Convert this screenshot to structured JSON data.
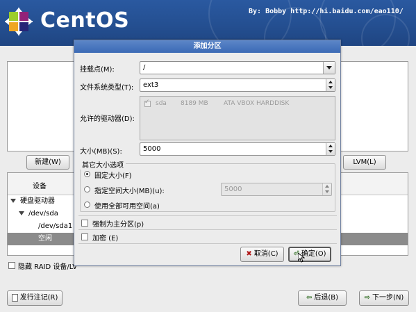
{
  "banner": {
    "logo_text": "CentOS",
    "byline": "By: Bobby http://hi.baidu.com/eao110/"
  },
  "main": {
    "new_button": "新建(W)",
    "lvm_button": "LVM(L)",
    "table": {
      "column_device": "设备",
      "rows": [
        {
          "label": "硬盘驱动器"
        },
        {
          "label": "/dev/sda"
        },
        {
          "label": "/dev/sda1"
        },
        {
          "label": "空闲"
        }
      ]
    },
    "hide_raid_label": "隐藏 RAID 设备/LV"
  },
  "dialog": {
    "title": "添加分区",
    "mount_point": {
      "label": "挂载点(M):",
      "value": "/"
    },
    "fs_type": {
      "label": "文件系统类型(T):",
      "value": "ext3"
    },
    "allowed_drives": {
      "label": "允许的驱动器(D):",
      "drives": [
        {
          "name": "sda",
          "size": "8189 MB",
          "model": "ATA VBOX HARDDISK",
          "checked": true
        }
      ]
    },
    "size": {
      "label": "大小(MB)(S):",
      "value": "5000"
    },
    "other_size": {
      "legend": "其它大小选项",
      "fixed": "固定大小(F)",
      "fill_to": "指定空间大小(MB)(u):",
      "fill_to_value": "5000",
      "fill_all": "使用全部可用空间(a)",
      "selected": "fixed"
    },
    "force_primary": "强制为主分区(p)",
    "encrypt": "加密 (E)",
    "cancel_button": "取消(C)",
    "ok_button": "确定(O)"
  },
  "footer": {
    "release_notes_button": "发行注记(R)",
    "back_button": "后退(B)",
    "next_button": "下一步(N)"
  },
  "colors": {
    "banner_blue": "#2a59a0",
    "dialog_title_blue": "#3b6ab5",
    "selected_row_gray": "#8b8b8b"
  }
}
